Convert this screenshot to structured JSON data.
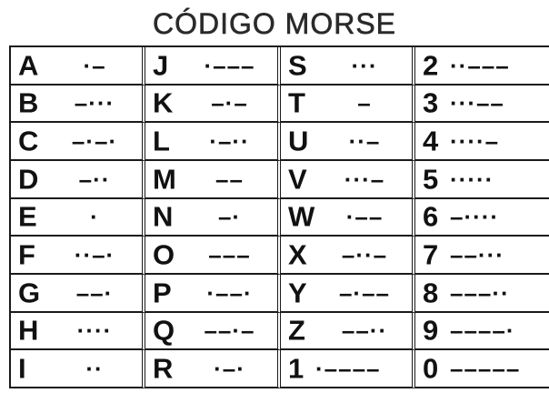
{
  "title": "CÓDIGO MORSE",
  "columns": [
    [
      {
        "char": "A",
        "code": "·–"
      },
      {
        "char": "B",
        "code": "–···"
      },
      {
        "char": "C",
        "code": "–·–·"
      },
      {
        "char": "D",
        "code": "–··"
      },
      {
        "char": "E",
        "code": "·"
      },
      {
        "char": "F",
        "code": "··–·"
      },
      {
        "char": "G",
        "code": "––·"
      },
      {
        "char": "H",
        "code": "····"
      },
      {
        "char": "I",
        "code": "··"
      }
    ],
    [
      {
        "char": "J",
        "code": "·–––"
      },
      {
        "char": "K",
        "code": "–·–"
      },
      {
        "char": "L",
        "code": "·–··"
      },
      {
        "char": "M",
        "code": "––"
      },
      {
        "char": "N",
        "code": "–·"
      },
      {
        "char": "O",
        "code": "–––"
      },
      {
        "char": "P",
        "code": "·––·"
      },
      {
        "char": "Q",
        "code": "––·–"
      },
      {
        "char": "R",
        "code": "·–·"
      }
    ],
    [
      {
        "char": "S",
        "code": "···"
      },
      {
        "char": "T",
        "code": "–"
      },
      {
        "char": "U",
        "code": "··–"
      },
      {
        "char": "V",
        "code": "···–"
      },
      {
        "char": "W",
        "code": "·––"
      },
      {
        "char": "X",
        "code": "–··–"
      },
      {
        "char": "Y",
        "code": "–·––"
      },
      {
        "char": "Z",
        "code": "––··"
      },
      {
        "char": "1",
        "code": "·––––"
      }
    ],
    [
      {
        "char": "2",
        "code": "··–––"
      },
      {
        "char": "3",
        "code": "···––"
      },
      {
        "char": "4",
        "code": "····–"
      },
      {
        "char": "5",
        "code": "·····"
      },
      {
        "char": "6",
        "code": "–····"
      },
      {
        "char": "7",
        "code": "––···"
      },
      {
        "char": "8",
        "code": "–––··"
      },
      {
        "char": "9",
        "code": "––––·"
      },
      {
        "char": "0",
        "code": "–––––"
      }
    ]
  ]
}
